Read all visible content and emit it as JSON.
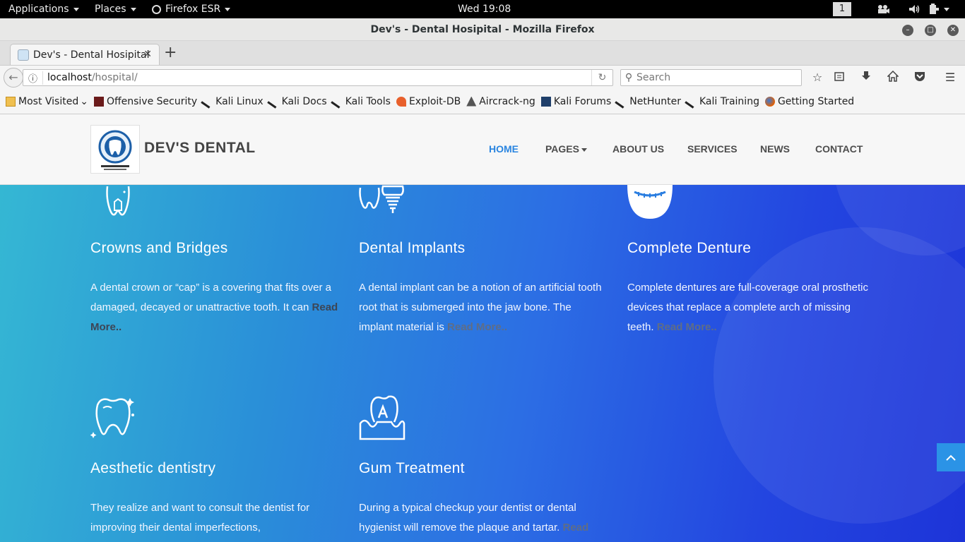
{
  "topbar": {
    "applications": "Applications",
    "places": "Places",
    "firefox": "Firefox ESR",
    "clock": "Wed 19:08",
    "workspace": "1"
  },
  "window": {
    "title": "Dev's - Dental Hosipital - Mozilla Firefox"
  },
  "tabs": [
    {
      "label": "Dev's - Dental Hosipital"
    }
  ],
  "urlbar": {
    "host": "localhost",
    "path": "/hospital/"
  },
  "search": {
    "placeholder": "Search"
  },
  "bookmarks": [
    {
      "label": "Most Visited",
      "icon": "folder-icon"
    },
    {
      "label": "Offensive Security",
      "icon": "offsec-icon"
    },
    {
      "label": "Kali Linux",
      "icon": "kali-icon"
    },
    {
      "label": "Kali Docs",
      "icon": "kali-icon"
    },
    {
      "label": "Kali Tools",
      "icon": "kali-icon"
    },
    {
      "label": "Exploit-DB",
      "icon": "exploitdb-icon"
    },
    {
      "label": "Aircrack-ng",
      "icon": "aircrack-icon"
    },
    {
      "label": "Kali Forums",
      "icon": "forums-icon"
    },
    {
      "label": "NetHunter",
      "icon": "kali-icon"
    },
    {
      "label": "Kali Training",
      "icon": "kali-icon"
    },
    {
      "label": "Getting Started",
      "icon": "firefox-icon"
    }
  ],
  "site": {
    "brand": "DEV'S DENTAL",
    "nav": {
      "home": "HOME",
      "pages": "PAGES",
      "about": "ABOUT US",
      "services": "SERVICES",
      "news": "NEWS",
      "contact": "CONTACT"
    },
    "services": [
      {
        "title": "Crowns and Bridges",
        "text": "A dental crown or “cap” is a covering that fits over a damaged, decayed or unattractive tooth. It can ",
        "more": "Read More.."
      },
      {
        "title": "Dental Implants",
        "text": "A dental implant can be a notion of an artificial tooth root that is submerged into the jaw bone. The implant material is ",
        "more": "Read More.."
      },
      {
        "title": "Complete Denture",
        "text": "Complete dentures are full-coverage oral prosthetic devices that replace a complete arch of missing teeth. ",
        "more": "Read More.."
      },
      {
        "title": "Aesthetic dentistry",
        "text": "They realize and want to consult the dentist for improving their dental imperfections,",
        "more": ""
      },
      {
        "title": "Gum Treatment",
        "text": "During a typical checkup your dentist or dental hygienist will remove the plaque and tartar. ",
        "more": "Read"
      }
    ]
  },
  "colors": {
    "accent": "#2a85e0",
    "gradient_start": "#35b9d3",
    "gradient_end": "#1d34d8"
  }
}
